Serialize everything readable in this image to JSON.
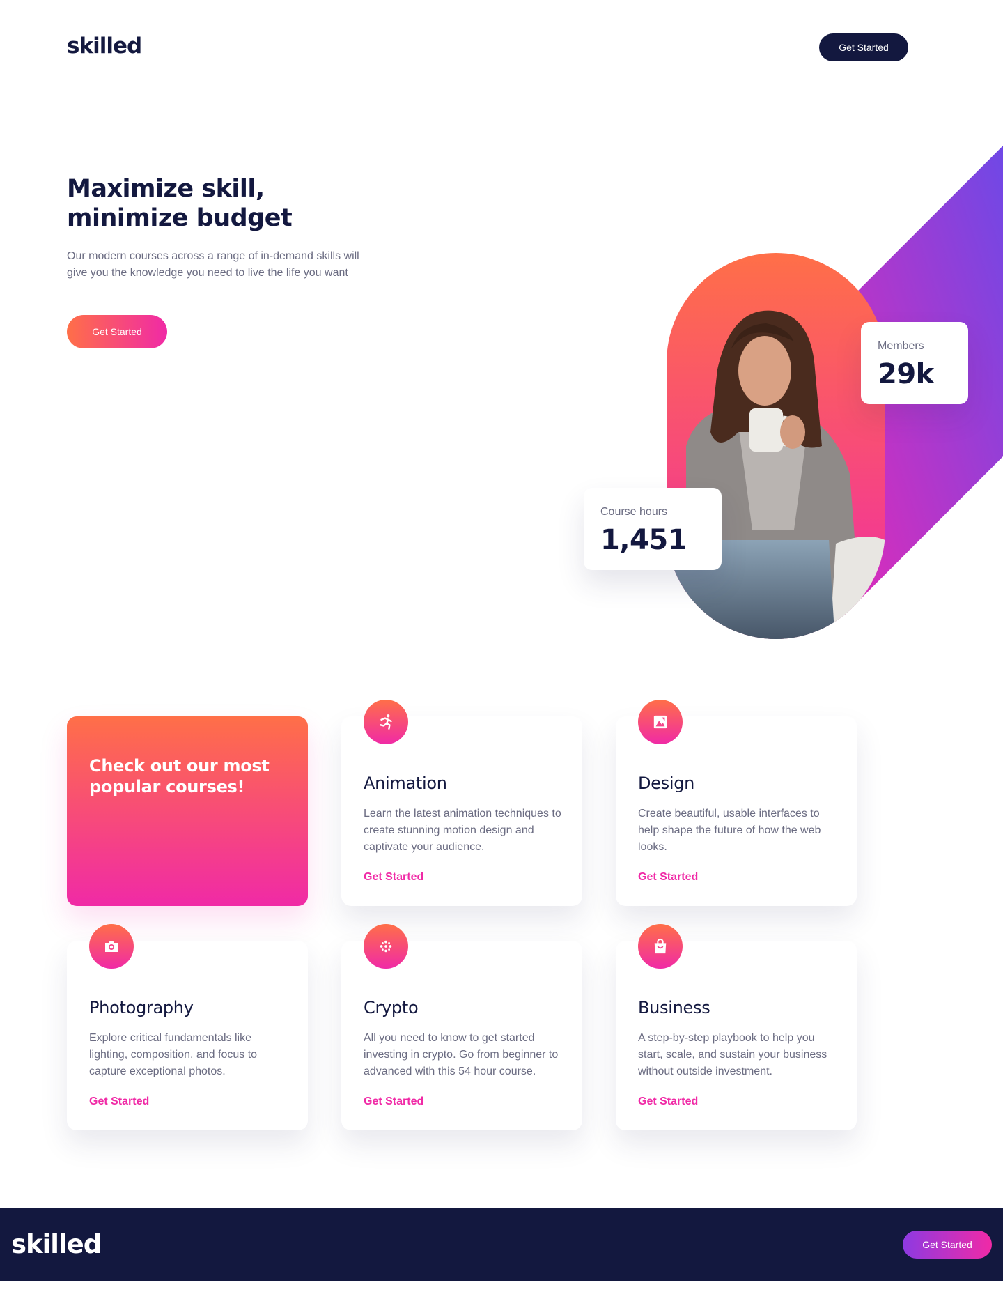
{
  "header": {
    "logo": "skilled",
    "cta_label": "Get Started"
  },
  "hero": {
    "title": "Maximize skill, minimize budget",
    "description": "Our modern courses across a range of in-demand skills will give you the knowledge you need to live the life you want",
    "cta_label": "Get Started"
  },
  "stats": {
    "members": {
      "label": "Members",
      "value": "29k"
    },
    "hours": {
      "label": "Course hours",
      "value": "1,451"
    }
  },
  "promo": {
    "title": "Check out our most popular courses!"
  },
  "courses": [
    {
      "title": "Animation",
      "description": "Learn the latest animation techniques to create stunning motion design and captivate your audience.",
      "link": "Get Started",
      "icon": "running-person-icon"
    },
    {
      "title": "Design",
      "description": "Create beautiful, usable interfaces to help shape the future of how the web looks.",
      "link": "Get Started",
      "icon": "image-icon"
    },
    {
      "title": "Photography",
      "description": "Explore critical fundamentals like lighting, composition, and focus to capture exceptional photos.",
      "link": "Get Started",
      "icon": "camera-icon"
    },
    {
      "title": "Crypto",
      "description": "All you need to know to get started investing in crypto. Go from beginner to advanced with this 54 hour course.",
      "link": "Get Started",
      "icon": "crypto-dots-icon"
    },
    {
      "title": "Business",
      "description": "A step-by-step playbook to help you start, scale, and sustain your business without outside investment.",
      "link": "Get Started",
      "icon": "shopping-bag-icon"
    }
  ],
  "footer": {
    "logo": "skilled",
    "cta_label": "Get Started"
  },
  "colors": {
    "navy": "#13183F",
    "orange": "#FF6F48",
    "pink": "#F02AA6",
    "purple": "#8D3AE2",
    "gray_text": "#6B6C82"
  }
}
